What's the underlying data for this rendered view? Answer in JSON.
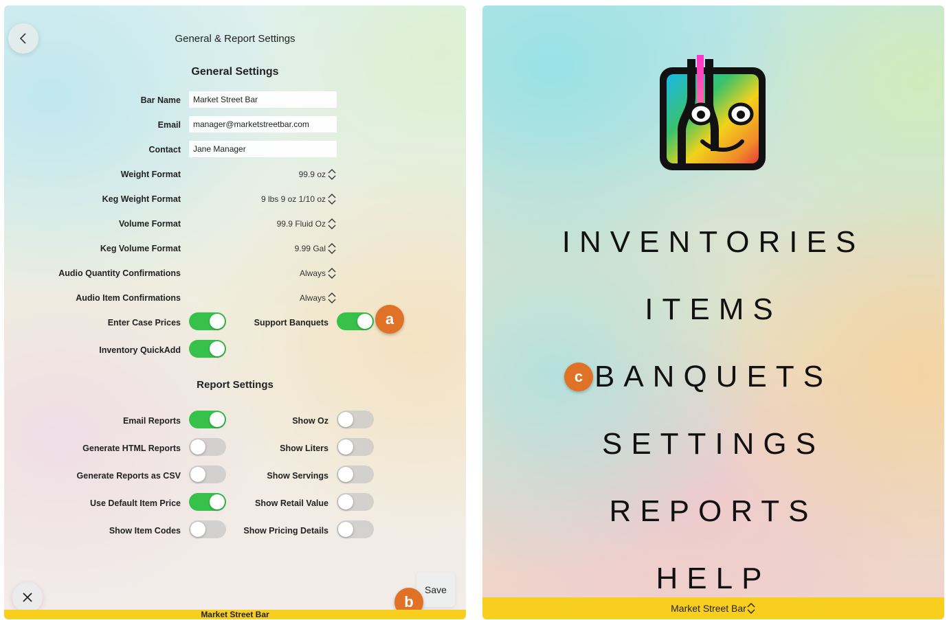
{
  "left": {
    "header": {
      "title": "General & Report Settings"
    },
    "general": {
      "title": "General Settings",
      "bar_name": {
        "label": "Bar Name",
        "value": "Market Street Bar"
      },
      "email": {
        "label": "Email",
        "value": "manager@marketstreetbar.com"
      },
      "contact": {
        "label": "Contact",
        "value": "Jane Manager"
      },
      "pickers": [
        {
          "label": "Weight Format",
          "value": "99.9 oz"
        },
        {
          "label": "Keg Weight Format",
          "value": "9 lbs 9 oz 1/10 oz"
        },
        {
          "label": "Volume Format",
          "value": "99.9 Fluid Oz"
        },
        {
          "label": "Keg Volume Format",
          "value": "9.99 Gal"
        },
        {
          "label": "Audio Quantity Confirmations",
          "value": "Always"
        },
        {
          "label": "Audio Item Confirmations",
          "value": "Always"
        }
      ],
      "toggles": {
        "enter_case_prices": {
          "label": "Enter Case Prices",
          "on": true
        },
        "support_banquets": {
          "label": "Support Banquets",
          "on": true
        },
        "inventory_quickadd": {
          "label": "Inventory QuickAdd",
          "on": true
        }
      }
    },
    "report": {
      "title": "Report Settings",
      "left_toggles": [
        {
          "label": "Email Reports",
          "on": true
        },
        {
          "label": "Generate HTML Reports",
          "on": false
        },
        {
          "label": "Generate Reports as CSV",
          "on": false
        },
        {
          "label": "Use Default Item Price",
          "on": true
        },
        {
          "label": "Show Item Codes",
          "on": false
        }
      ],
      "right_toggles": [
        {
          "label": "Show Oz",
          "on": false
        },
        {
          "label": "Show Liters",
          "on": false
        },
        {
          "label": "Show Servings",
          "on": false
        },
        {
          "label": "Show Retail Value",
          "on": false
        },
        {
          "label": "Show Pricing Details",
          "on": false
        }
      ]
    },
    "save_label": "Save",
    "footer": "Market Street Bar"
  },
  "badges": {
    "a": "a",
    "b": "b",
    "c": "c"
  },
  "badge_color": "#e07228",
  "toggle_on_color": "#36c24a",
  "footer_color": "#f8cf1e",
  "right": {
    "menu": [
      "INVENTORIES",
      "ITEMS",
      "BANQUETS",
      "SETTINGS",
      "REPORTS",
      "HELP"
    ],
    "footer": "Market Street Bar"
  }
}
